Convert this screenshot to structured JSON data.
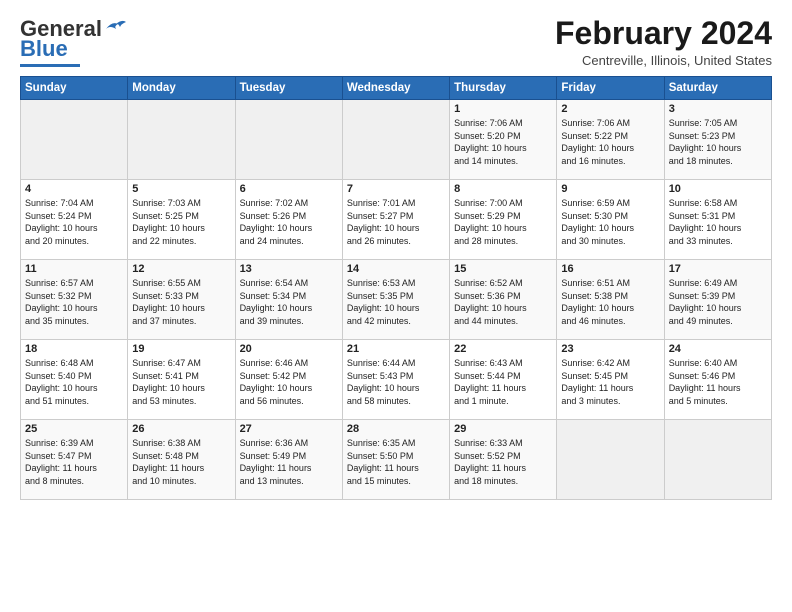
{
  "header": {
    "logo_general": "General",
    "logo_blue": "Blue",
    "month_title": "February 2024",
    "location": "Centreville, Illinois, United States"
  },
  "days_of_week": [
    "Sunday",
    "Monday",
    "Tuesday",
    "Wednesday",
    "Thursday",
    "Friday",
    "Saturday"
  ],
  "weeks": [
    [
      {
        "day": "",
        "info": ""
      },
      {
        "day": "",
        "info": ""
      },
      {
        "day": "",
        "info": ""
      },
      {
        "day": "",
        "info": ""
      },
      {
        "day": "1",
        "info": "Sunrise: 7:06 AM\nSunset: 5:20 PM\nDaylight: 10 hours\nand 14 minutes."
      },
      {
        "day": "2",
        "info": "Sunrise: 7:06 AM\nSunset: 5:22 PM\nDaylight: 10 hours\nand 16 minutes."
      },
      {
        "day": "3",
        "info": "Sunrise: 7:05 AM\nSunset: 5:23 PM\nDaylight: 10 hours\nand 18 minutes."
      }
    ],
    [
      {
        "day": "4",
        "info": "Sunrise: 7:04 AM\nSunset: 5:24 PM\nDaylight: 10 hours\nand 20 minutes."
      },
      {
        "day": "5",
        "info": "Sunrise: 7:03 AM\nSunset: 5:25 PM\nDaylight: 10 hours\nand 22 minutes."
      },
      {
        "day": "6",
        "info": "Sunrise: 7:02 AM\nSunset: 5:26 PM\nDaylight: 10 hours\nand 24 minutes."
      },
      {
        "day": "7",
        "info": "Sunrise: 7:01 AM\nSunset: 5:27 PM\nDaylight: 10 hours\nand 26 minutes."
      },
      {
        "day": "8",
        "info": "Sunrise: 7:00 AM\nSunset: 5:29 PM\nDaylight: 10 hours\nand 28 minutes."
      },
      {
        "day": "9",
        "info": "Sunrise: 6:59 AM\nSunset: 5:30 PM\nDaylight: 10 hours\nand 30 minutes."
      },
      {
        "day": "10",
        "info": "Sunrise: 6:58 AM\nSunset: 5:31 PM\nDaylight: 10 hours\nand 33 minutes."
      }
    ],
    [
      {
        "day": "11",
        "info": "Sunrise: 6:57 AM\nSunset: 5:32 PM\nDaylight: 10 hours\nand 35 minutes."
      },
      {
        "day": "12",
        "info": "Sunrise: 6:55 AM\nSunset: 5:33 PM\nDaylight: 10 hours\nand 37 minutes."
      },
      {
        "day": "13",
        "info": "Sunrise: 6:54 AM\nSunset: 5:34 PM\nDaylight: 10 hours\nand 39 minutes."
      },
      {
        "day": "14",
        "info": "Sunrise: 6:53 AM\nSunset: 5:35 PM\nDaylight: 10 hours\nand 42 minutes."
      },
      {
        "day": "15",
        "info": "Sunrise: 6:52 AM\nSunset: 5:36 PM\nDaylight: 10 hours\nand 44 minutes."
      },
      {
        "day": "16",
        "info": "Sunrise: 6:51 AM\nSunset: 5:38 PM\nDaylight: 10 hours\nand 46 minutes."
      },
      {
        "day": "17",
        "info": "Sunrise: 6:49 AM\nSunset: 5:39 PM\nDaylight: 10 hours\nand 49 minutes."
      }
    ],
    [
      {
        "day": "18",
        "info": "Sunrise: 6:48 AM\nSunset: 5:40 PM\nDaylight: 10 hours\nand 51 minutes."
      },
      {
        "day": "19",
        "info": "Sunrise: 6:47 AM\nSunset: 5:41 PM\nDaylight: 10 hours\nand 53 minutes."
      },
      {
        "day": "20",
        "info": "Sunrise: 6:46 AM\nSunset: 5:42 PM\nDaylight: 10 hours\nand 56 minutes."
      },
      {
        "day": "21",
        "info": "Sunrise: 6:44 AM\nSunset: 5:43 PM\nDaylight: 10 hours\nand 58 minutes."
      },
      {
        "day": "22",
        "info": "Sunrise: 6:43 AM\nSunset: 5:44 PM\nDaylight: 11 hours\nand 1 minute."
      },
      {
        "day": "23",
        "info": "Sunrise: 6:42 AM\nSunset: 5:45 PM\nDaylight: 11 hours\nand 3 minutes."
      },
      {
        "day": "24",
        "info": "Sunrise: 6:40 AM\nSunset: 5:46 PM\nDaylight: 11 hours\nand 5 minutes."
      }
    ],
    [
      {
        "day": "25",
        "info": "Sunrise: 6:39 AM\nSunset: 5:47 PM\nDaylight: 11 hours\nand 8 minutes."
      },
      {
        "day": "26",
        "info": "Sunrise: 6:38 AM\nSunset: 5:48 PM\nDaylight: 11 hours\nand 10 minutes."
      },
      {
        "day": "27",
        "info": "Sunrise: 6:36 AM\nSunset: 5:49 PM\nDaylight: 11 hours\nand 13 minutes."
      },
      {
        "day": "28",
        "info": "Sunrise: 6:35 AM\nSunset: 5:50 PM\nDaylight: 11 hours\nand 15 minutes."
      },
      {
        "day": "29",
        "info": "Sunrise: 6:33 AM\nSunset: 5:52 PM\nDaylight: 11 hours\nand 18 minutes."
      },
      {
        "day": "",
        "info": ""
      },
      {
        "day": "",
        "info": ""
      }
    ]
  ]
}
